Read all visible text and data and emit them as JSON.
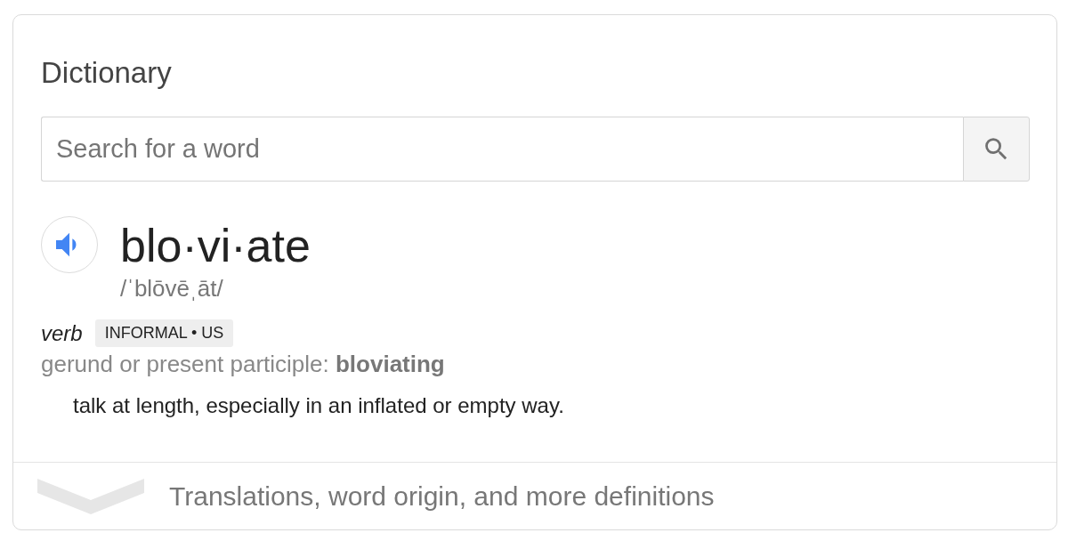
{
  "card": {
    "title": "Dictionary",
    "search": {
      "placeholder": "Search for a word"
    },
    "entry": {
      "word": "blo·vi·ate",
      "pronunciation": "/ˈblōvēˌāt/",
      "part_of_speech": "verb",
      "labels": "INFORMAL • US",
      "forms": "gerund or present participle: **bloviating**",
      "definitions": [
        "talk at length, especially in an inflated or empty way."
      ]
    },
    "more": {
      "label": "Translations, word origin, and more definitions"
    }
  }
}
